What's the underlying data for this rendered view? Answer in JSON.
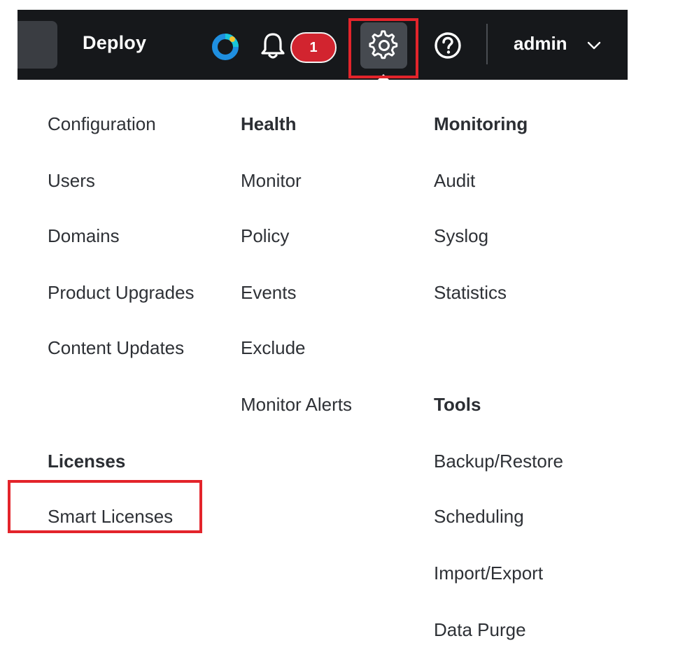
{
  "topbar": {
    "deploy_label": "Deploy",
    "notifications_count": "1",
    "user_label": "admin",
    "brand_icon": "app-logo-icon",
    "bell_icon": "bell-icon",
    "settings_icon": "gear-icon",
    "help_icon": "help-icon",
    "user_menu_icon": "chevron-down-icon",
    "colors": {
      "bar": "#16181b",
      "badge": "#d2242f",
      "highlight": "#e3242b"
    }
  },
  "menu": {
    "col1": {
      "configuration": "Configuration",
      "users": "Users",
      "domains": "Domains",
      "product_upgrades": "Product Upgrades",
      "content_updates": "Content Updates",
      "licenses_heading": "Licenses",
      "smart_licenses": "Smart Licenses"
    },
    "col2": {
      "health_heading": "Health",
      "monitor": "Monitor",
      "policy": "Policy",
      "events": "Events",
      "exclude": "Exclude",
      "monitor_alerts": "Monitor Alerts"
    },
    "col3": {
      "monitoring_heading": "Monitoring",
      "audit": "Audit",
      "syslog": "Syslog",
      "statistics": "Statistics",
      "tools_heading": "Tools",
      "backup_restore": "Backup/Restore",
      "scheduling": "Scheduling",
      "import_export": "Import/Export",
      "data_purge": "Data Purge"
    }
  }
}
